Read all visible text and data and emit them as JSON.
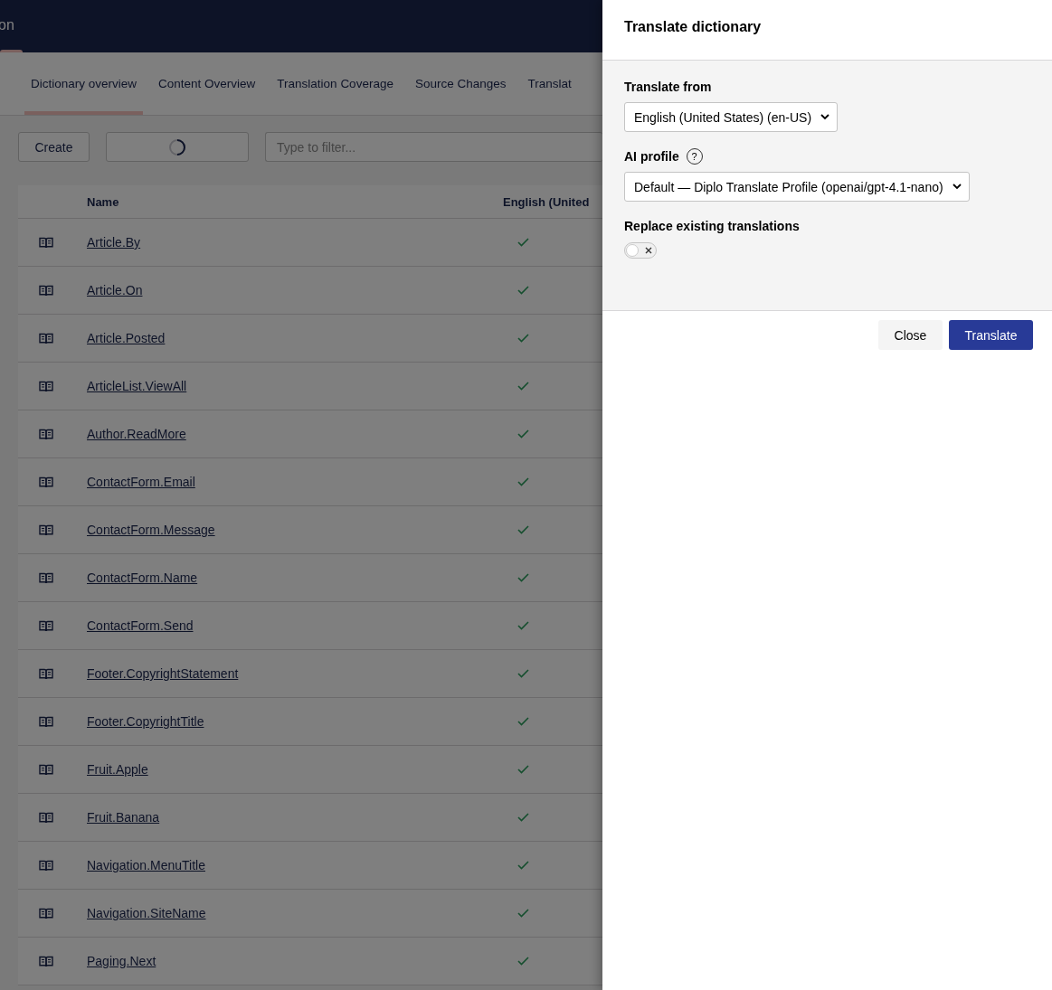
{
  "header": {
    "title": "on"
  },
  "tabs": [
    {
      "label": "Dictionary overview",
      "selected": true
    },
    {
      "label": "Content Overview",
      "selected": false
    },
    {
      "label": "Translation Coverage",
      "selected": false
    },
    {
      "label": "Source Changes",
      "selected": false
    },
    {
      "label": "Translat",
      "selected": false
    }
  ],
  "toolbar": {
    "create_button": "Create",
    "loading_button": {
      "loading": true
    },
    "filter": {
      "placeholder": "Type to filter..."
    }
  },
  "table": {
    "columns": [
      "Name",
      "English (United"
    ],
    "rows": [
      {
        "name": "Article.By",
        "translated": true
      },
      {
        "name": "Article.On",
        "translated": true
      },
      {
        "name": "Article.Posted",
        "translated": true
      },
      {
        "name": "ArticleList.ViewAll",
        "translated": true
      },
      {
        "name": "Author.ReadMore",
        "translated": true
      },
      {
        "name": "ContactForm.Email",
        "translated": true
      },
      {
        "name": "ContactForm.Message",
        "translated": true
      },
      {
        "name": "ContactForm.Name",
        "translated": true
      },
      {
        "name": "ContactForm.Send",
        "translated": true
      },
      {
        "name": "Footer.CopyrightStatement",
        "translated": true
      },
      {
        "name": "Footer.CopyrightTitle",
        "translated": true
      },
      {
        "name": "Fruit.Apple",
        "translated": true
      },
      {
        "name": "Fruit.Banana",
        "translated": true
      },
      {
        "name": "Navigation.MenuTitle",
        "translated": true
      },
      {
        "name": "Navigation.SiteName",
        "translated": true
      },
      {
        "name": "Paging.Next",
        "translated": true
      }
    ]
  },
  "panel": {
    "title": "Translate dictionary",
    "translate_from": {
      "label": "Translate from",
      "value": "English (United States) (en-US)"
    },
    "ai_profile": {
      "label": "AI profile",
      "help": "?",
      "value": "Default — Diplo Translate Profile (openai/gpt-4.1-nano)"
    },
    "replace_existing": {
      "label": "Replace existing translations",
      "checked": false
    },
    "buttons": [
      {
        "label": "Close",
        "kind": "secondary"
      },
      {
        "label": "Translate",
        "kind": "primary"
      }
    ]
  }
}
